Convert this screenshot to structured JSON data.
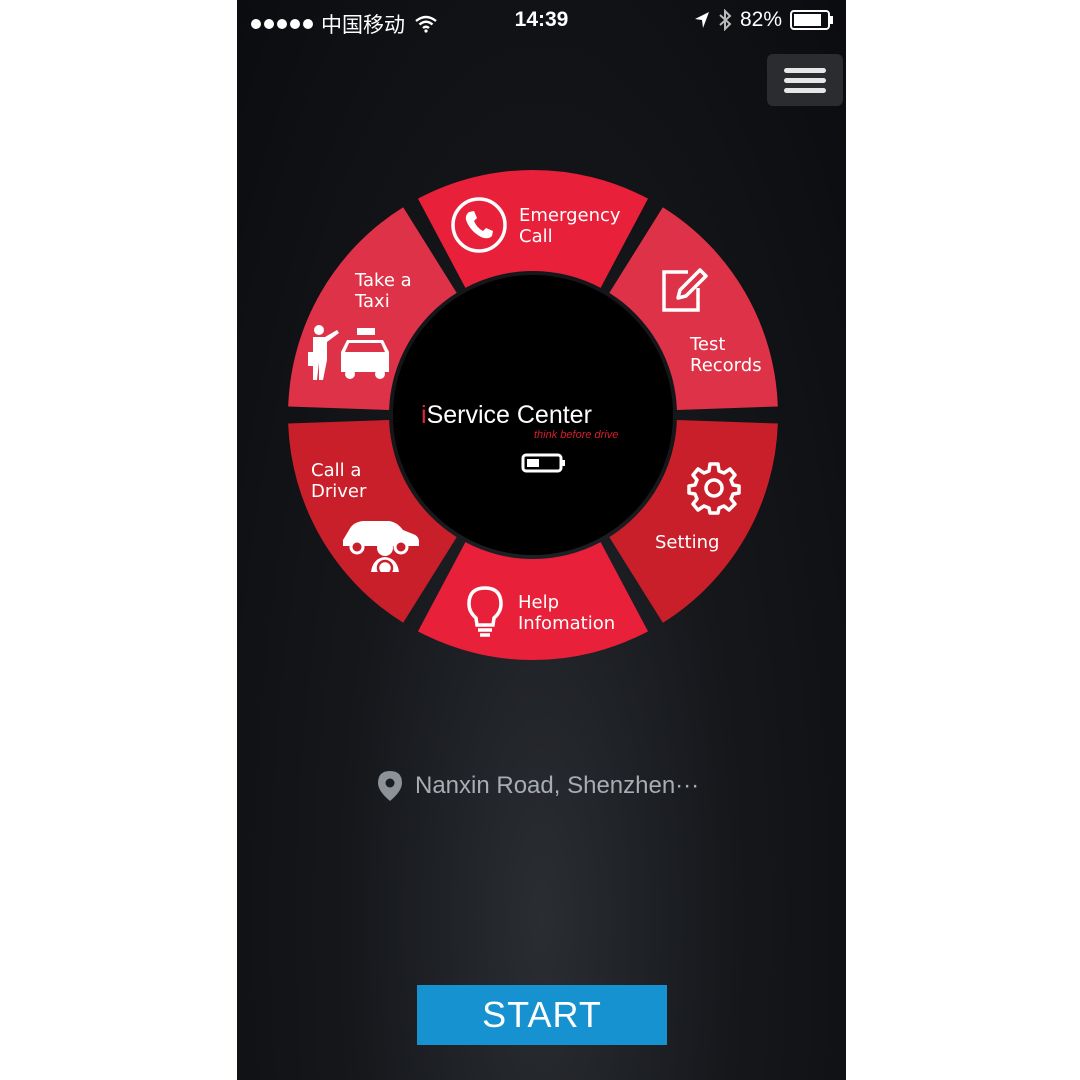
{
  "status_bar": {
    "carrier": "中国移动",
    "time": "14:39",
    "battery": "82%",
    "icons": [
      "signal-dots",
      "wifi-icon",
      "location-arrow-icon",
      "bluetooth-icon",
      "battery-icon"
    ]
  },
  "menu": {
    "icon": "hamburger-menu-icon"
  },
  "wheel": {
    "segments": [
      {
        "label_lines": [
          "Emergency",
          "Call"
        ],
        "icon": "phone-icon",
        "color": "#e8203a"
      },
      {
        "label_lines": [
          "Test",
          "Records"
        ],
        "icon": "edit-icon",
        "color": "#dd3247"
      },
      {
        "label_lines": [
          "Setting"
        ],
        "icon": "gear-icon",
        "color": "#c91f2a"
      },
      {
        "label_lines": [
          "Help",
          "Infomation"
        ],
        "icon": "lightbulb-icon",
        "color": "#e8203a"
      },
      {
        "label_lines": [
          "Call a",
          "Driver"
        ],
        "icon": "car-driver-icon",
        "color": "#c91f2a"
      },
      {
        "label_lines": [
          "Take a",
          "Taxi"
        ],
        "icon": "taxi-icon",
        "color": "#dd3247"
      }
    ],
    "center": {
      "title_i": "i",
      "title_rest": "Service Center",
      "tagline": "think before drive",
      "icon": "battery-low-icon"
    }
  },
  "location": {
    "text": "Nanxin Road, Shenzhen···",
    "icon": "location-pin-icon"
  },
  "start_button": {
    "label": "START",
    "color": "#1592cf"
  }
}
